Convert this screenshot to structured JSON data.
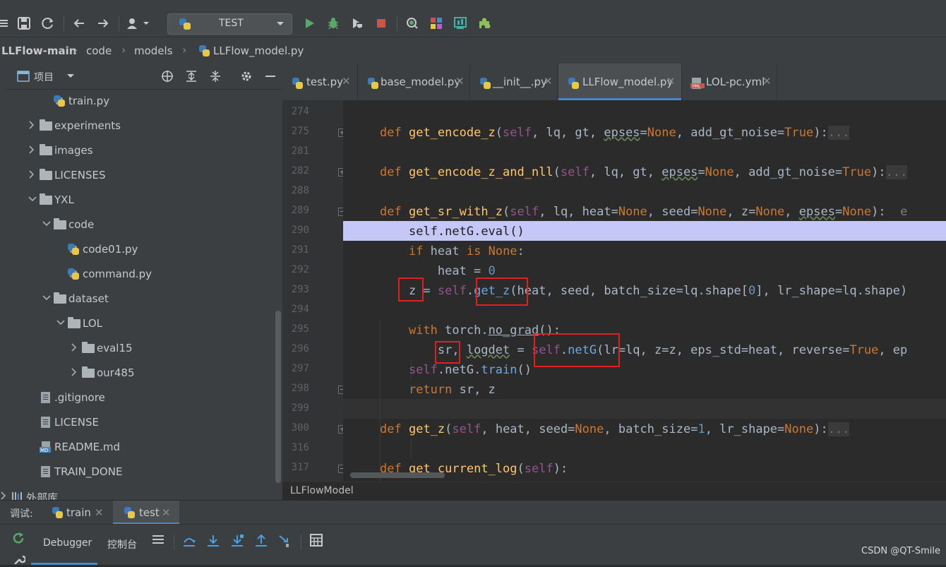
{
  "toolbar": {
    "run_config": "TEST",
    "icons": [
      "menu-icon",
      "save-icon",
      "sync-icon",
      "back-icon",
      "forward-icon",
      "user-icon",
      "run-icon",
      "debug-icon",
      "coverage-icon",
      "stop-icon",
      "search-icon",
      "layout-icon",
      "analysis-icon",
      "plugin-icon"
    ]
  },
  "breadcrumb": [
    "LLFlow-main",
    "code",
    "models",
    "LLFlow_model.py"
  ],
  "project": {
    "title": "项目",
    "items": [
      {
        "label": "train.py",
        "type": "py"
      },
      {
        "label": "experiments",
        "type": "folder"
      },
      {
        "label": "images",
        "type": "folder"
      },
      {
        "label": "LICENSES",
        "type": "folder"
      },
      {
        "label": "YXL",
        "type": "folder"
      },
      {
        "label": "code",
        "type": "folder"
      },
      {
        "label": "code01.py",
        "type": "py"
      },
      {
        "label": "command.py",
        "type": "py"
      },
      {
        "label": "dataset",
        "type": "folder"
      },
      {
        "label": "LOL",
        "type": "folder"
      },
      {
        "label": "eval15",
        "type": "folder"
      },
      {
        "label": "our485",
        "type": "folder"
      },
      {
        "label": ".gitignore",
        "type": "file"
      },
      {
        "label": "LICENSE",
        "type": "file"
      },
      {
        "label": "README.md",
        "type": "md"
      },
      {
        "label": "TRAIN_DONE",
        "type": "file"
      },
      {
        "label": "外部库",
        "type": "lib"
      }
    ]
  },
  "tabs": [
    {
      "label": "test.py"
    },
    {
      "label": "base_model.py"
    },
    {
      "label": "__init__.py"
    },
    {
      "label": "LLFlow_model.py"
    },
    {
      "label": "LOL-pc.yml"
    }
  ],
  "line_numbers": [
    "274",
    "275",
    "281",
    "282",
    "288",
    "289",
    "290",
    "291",
    "292",
    "293",
    "294",
    "295",
    "296",
    "297",
    "298",
    "299",
    "300",
    "316",
    "317"
  ],
  "code_hint": "e",
  "status_class": "LLFlowModel",
  "debug": {
    "label": "调试:",
    "tabs": [
      "train",
      "test"
    ],
    "buttons": [
      "Debugger",
      "控制台"
    ]
  },
  "watermark": "CSDN @QT-Smile",
  "colors": {
    "highlight_line": "#c5c7f6",
    "annotation_box": "#e02020",
    "active_tab_underline": "#4a88c7"
  }
}
